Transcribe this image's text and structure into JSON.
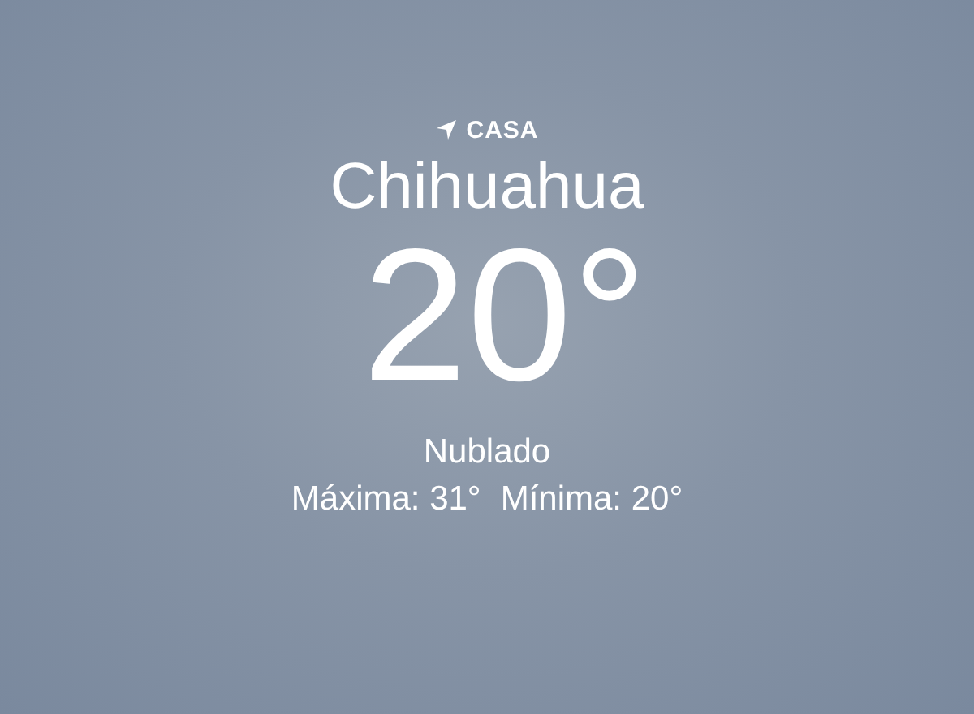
{
  "location": {
    "label": "CASA"
  },
  "city": "Chihuahua",
  "temperature": "20°",
  "condition": "Nublado",
  "range": [
    {
      "text": "Máxima: 31°"
    },
    {
      "text": "Mínima: 20°"
    }
  ]
}
